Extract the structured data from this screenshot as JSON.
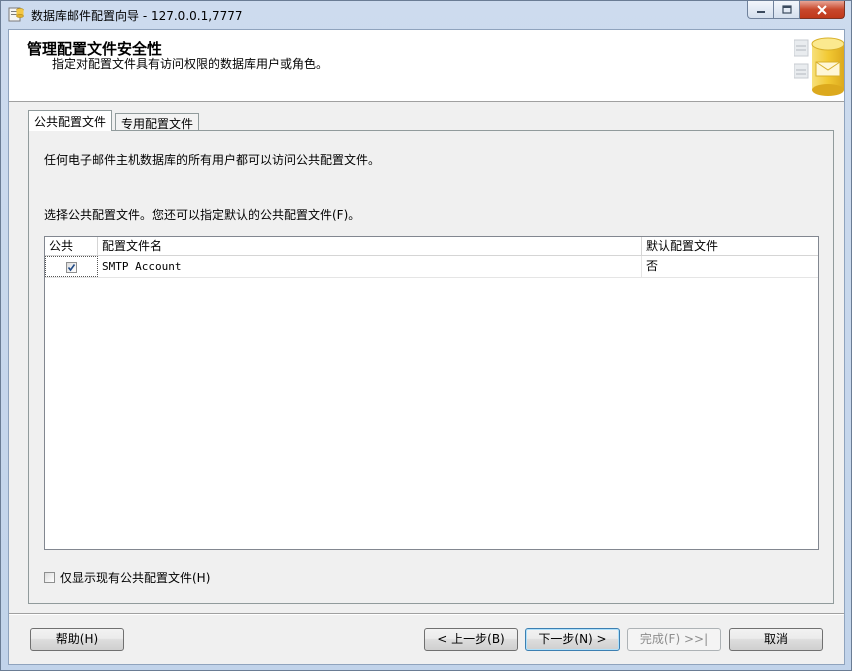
{
  "window": {
    "title": "数据库邮件配置向导 - 127.0.0.1,7777"
  },
  "header": {
    "title": "管理配置文件安全性",
    "subtitle": "指定对配置文件具有访问权限的数据库用户或角色。"
  },
  "tabs": [
    {
      "label": "公共配置文件",
      "active": true
    },
    {
      "label": "专用配置文件",
      "active": false
    }
  ],
  "panel": {
    "description": "任何电子邮件主机数据库的所有用户都可以访问公共配置文件。",
    "instruction": "选择公共配置文件。您还可以指定默认的公共配置文件(F)。"
  },
  "grid": {
    "columns": [
      "公共",
      "配置文件名",
      "默认配置文件"
    ],
    "rows": [
      {
        "public": true,
        "name": "SMTP Account",
        "default": "否"
      }
    ]
  },
  "show_existing": {
    "label": "仅显示现有公共配置文件(H)",
    "checked": false
  },
  "buttons": {
    "help": "帮助(H)",
    "back": "< 上一步(B)",
    "next": "下一步(N) >",
    "finish": "完成(F) >>|",
    "cancel": "取消"
  }
}
